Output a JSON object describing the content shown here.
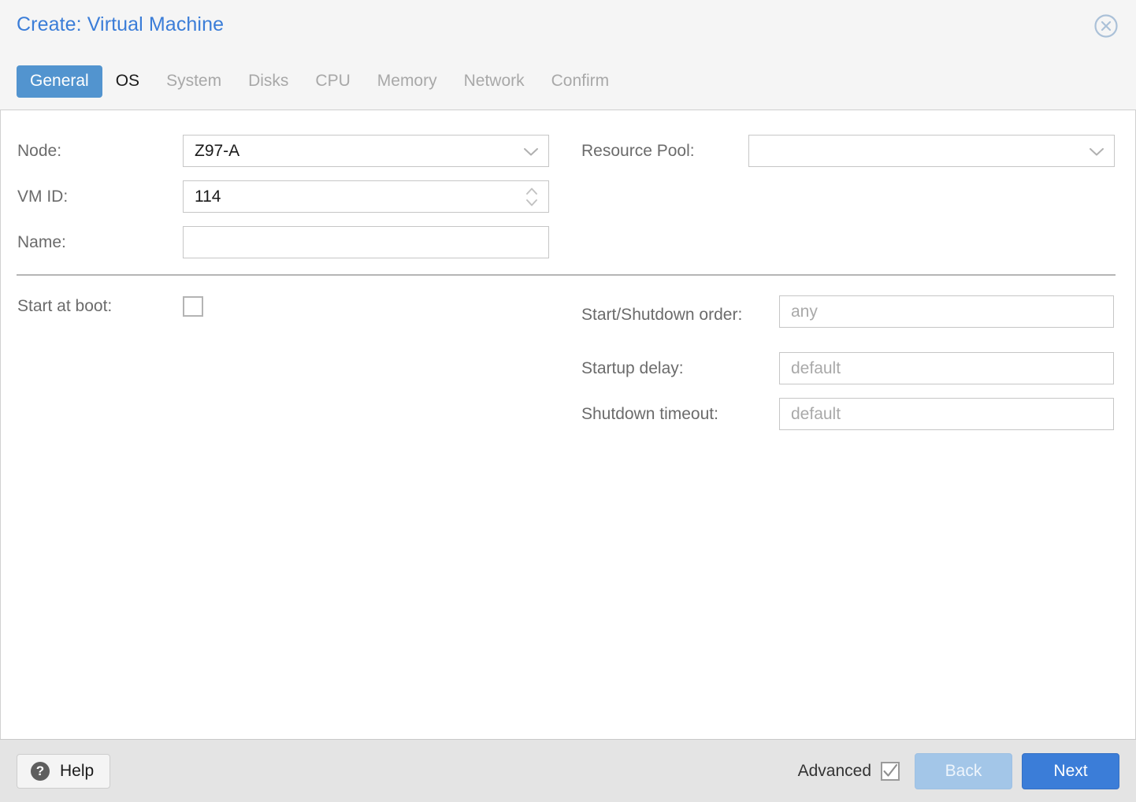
{
  "dialog": {
    "title": "Create: Virtual Machine",
    "close_icon": "close-circle-icon"
  },
  "tabs": [
    {
      "label": "General",
      "state": "active"
    },
    {
      "label": "OS",
      "state": "enabled"
    },
    {
      "label": "System",
      "state": "disabled"
    },
    {
      "label": "Disks",
      "state": "disabled"
    },
    {
      "label": "CPU",
      "state": "disabled"
    },
    {
      "label": "Memory",
      "state": "disabled"
    },
    {
      "label": "Network",
      "state": "disabled"
    },
    {
      "label": "Confirm",
      "state": "disabled"
    }
  ],
  "form": {
    "left": {
      "node": {
        "label": "Node:",
        "value": "Z97-A",
        "icon": "chevron-down-icon"
      },
      "vmid": {
        "label": "VM ID:",
        "value": "114",
        "icon": "spinner-updown-icon"
      },
      "name": {
        "label": "Name:",
        "value": "",
        "placeholder": ""
      },
      "start_at_boot": {
        "label": "Start at boot:",
        "checked": false
      }
    },
    "right": {
      "resource_pool": {
        "label": "Resource Pool:",
        "value": "",
        "icon": "chevron-down-icon"
      },
      "start_shutdown_order": {
        "label": "Start/Shutdown order:",
        "value": "",
        "placeholder": "any"
      },
      "startup_delay": {
        "label": "Startup delay:",
        "value": "",
        "placeholder": "default"
      },
      "shutdown_timeout": {
        "label": "Shutdown timeout:",
        "value": "",
        "placeholder": "default"
      }
    }
  },
  "footer": {
    "help_label": "Help",
    "help_icon": "question-mark-icon",
    "advanced_label": "Advanced",
    "advanced_checked": true,
    "back_label": "Back",
    "next_label": "Next"
  },
  "colors": {
    "accent_blue": "#3b7dd8",
    "tab_active_blue": "#5294cf",
    "next_button_blue": "#3b7dd8",
    "back_button_blue": "#a3c6e8",
    "header_bg": "#f5f5f5",
    "footer_bg": "#e4e4e4",
    "label_gray": "#6b6b6b",
    "placeholder_gray": "#a9a9a9",
    "disabled_tab_gray": "#a8a8a8"
  }
}
